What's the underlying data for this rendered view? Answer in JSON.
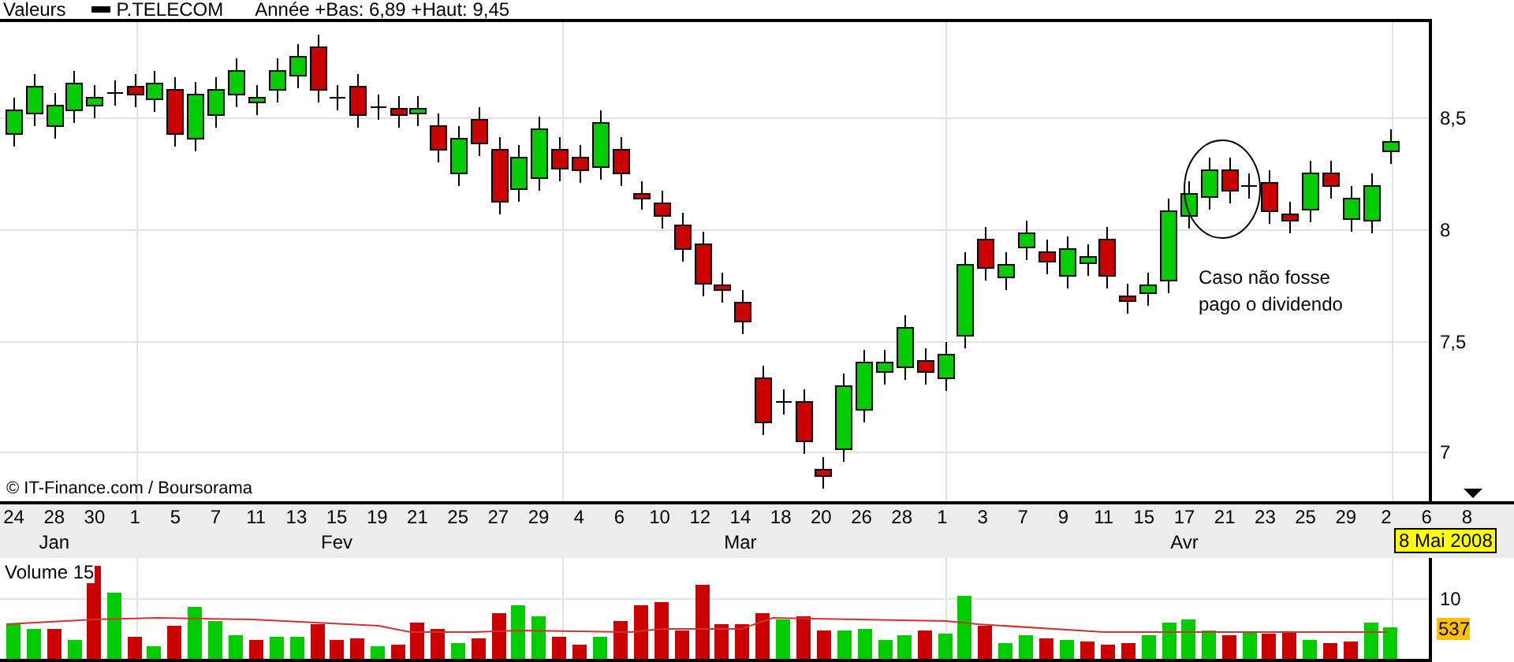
{
  "header": {
    "label": "Valeurs",
    "series": "P.TELECOM",
    "range": "Année +Bas: 6,89 +Haut: 9,45"
  },
  "price_axis": {
    "labels": [
      "8,5",
      "8",
      "7,5",
      "7"
    ]
  },
  "annotation": "Caso não fosse pago o dividendo",
  "credit": "© IT-Finance.com / Boursorama",
  "dates": [
    {
      "label": "24"
    },
    {
      "label": "28",
      "month": "Jan"
    },
    {
      "label": "30"
    },
    {
      "label": "1"
    },
    {
      "label": "5"
    },
    {
      "label": "7"
    },
    {
      "label": "11"
    },
    {
      "label": "13"
    },
    {
      "label": "15",
      "month": "Fev"
    },
    {
      "label": "19"
    },
    {
      "label": "21"
    },
    {
      "label": "25"
    },
    {
      "label": "27"
    },
    {
      "label": "29"
    },
    {
      "label": "4"
    },
    {
      "label": "6"
    },
    {
      "label": "10"
    },
    {
      "label": "12"
    },
    {
      "label": "14",
      "month": "Mar"
    },
    {
      "label": "18"
    },
    {
      "label": "20"
    },
    {
      "label": "26"
    },
    {
      "label": "28"
    },
    {
      "label": "1"
    },
    {
      "label": "3"
    },
    {
      "label": "7"
    },
    {
      "label": "9"
    },
    {
      "label": "11"
    },
    {
      "label": "15"
    },
    {
      "label": "17",
      "month": "Avr"
    },
    {
      "label": "21"
    },
    {
      "label": "23"
    },
    {
      "label": "25"
    },
    {
      "label": "29"
    },
    {
      "label": "2"
    },
    {
      "label": "6"
    },
    {
      "label": "8"
    }
  ],
  "current_date": "8 Mai 2008",
  "volume": {
    "title": "Volume 15",
    "axis_label": "10",
    "current_value": "537"
  }
}
